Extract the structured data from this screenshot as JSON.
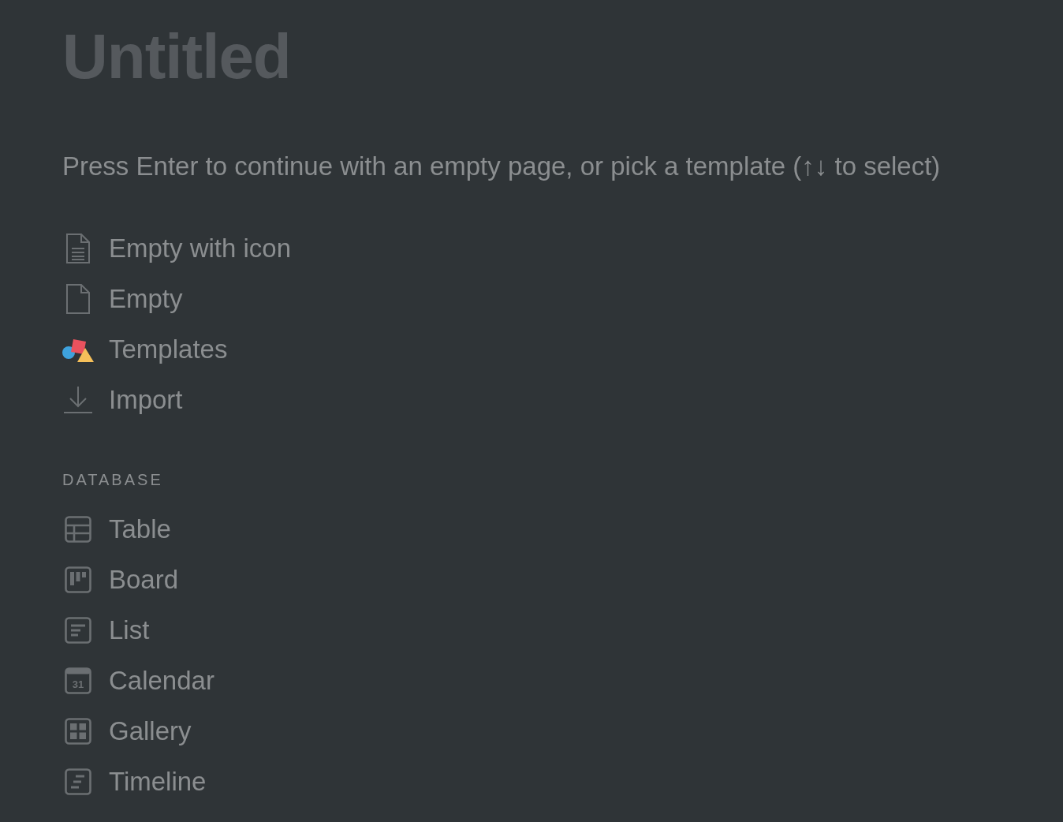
{
  "title": {
    "placeholder": "Untitled"
  },
  "hint": "Press Enter to continue with an empty page, or pick a template (↑↓ to select)",
  "page_options": [
    {
      "kind": "doc-lines",
      "label": "Empty with icon"
    },
    {
      "kind": "doc",
      "label": "Empty"
    },
    {
      "kind": "templates",
      "label": "Templates"
    },
    {
      "kind": "import",
      "label": "Import"
    }
  ],
  "database": {
    "heading": "DATABASE",
    "items": [
      {
        "kind": "table",
        "label": "Table"
      },
      {
        "kind": "board",
        "label": "Board"
      },
      {
        "kind": "list",
        "label": "List"
      },
      {
        "kind": "calendar",
        "label": "Calendar",
        "icon_text": "31"
      },
      {
        "kind": "gallery",
        "label": "Gallery"
      },
      {
        "kind": "timeline",
        "label": "Timeline"
      }
    ]
  }
}
